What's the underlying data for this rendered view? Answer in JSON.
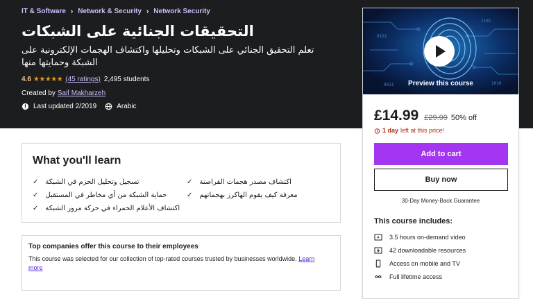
{
  "breadcrumbs": [
    "IT & Software",
    "Network & Security",
    "Network Security"
  ],
  "course": {
    "title": "التحقيقات الجنائية على الشبكات",
    "subtitle": "تعلم التحقيق الجنائي على الشبكات وتحليلها واكتشاف الهجمات الإلكترونية على الشبكة وحمايتها منها",
    "rating": "4.6",
    "stars": "★★★★★",
    "ratings_count": "(45 ratings)",
    "students": "2,495 students",
    "created_by_label": "Created by",
    "instructor": "Saif Makharzeh",
    "last_updated": "Last updated 2/2019",
    "language": "Arabic"
  },
  "sidebar": {
    "preview_label": "Preview this course",
    "price": "£14.99",
    "original_price": "£29.99",
    "discount": "50% off",
    "timer_bold": "1 day",
    "timer_text": "left at this price!",
    "add_to_cart": "Add to cart",
    "buy_now": "Buy now",
    "guarantee": "30-Day Money-Back Guarantee",
    "includes_title": "This course includes:",
    "includes": [
      {
        "icon": "video-icon",
        "text": "3.5 hours on-demand video"
      },
      {
        "icon": "download-icon",
        "text": "42 downloadable resources"
      },
      {
        "icon": "mobile-icon",
        "text": "Access on mobile and TV"
      },
      {
        "icon": "infinity-icon",
        "text": "Full lifetime access"
      }
    ]
  },
  "learn": {
    "title": "What you'll learn",
    "items": [
      "تسجيل وتحليل الحزم في الشبكة",
      "حماية الشبكة من أي مخاطر في المستقبل",
      "اكتشاف الأعلام الحمراء في حركة مرور الشبكة",
      "اكتشاف مصدر هجمات القراصنة",
      "معرفة كيف يقوم الهاكرز بهجماتهم"
    ]
  },
  "companies": {
    "title": "Top companies offer this course to their employees",
    "text": "This course was selected for our collection of top-rated courses trusted by businesses worldwide.",
    "learn_more": "Learn more"
  },
  "colors": {
    "hero_bg": "#1c1d1f",
    "accent": "#a435f0",
    "link": "#cec0fc",
    "star": "#e59819"
  }
}
